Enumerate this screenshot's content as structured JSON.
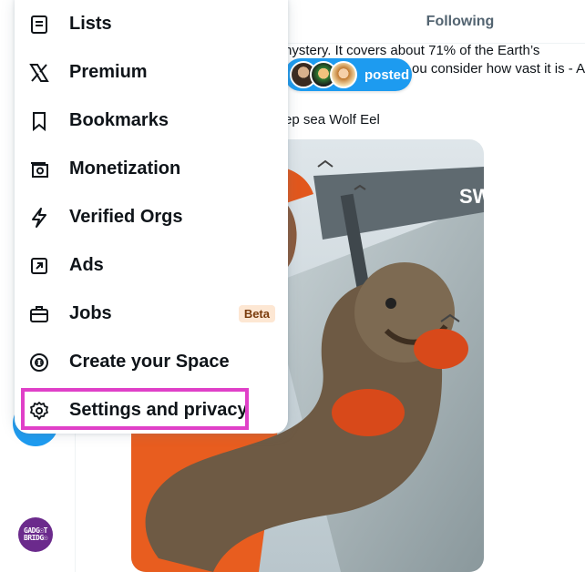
{
  "timeline": {
    "tab_following": "Following",
    "post_line1": "nystery. It covers about 71% of the Earth’s",
    "post_line2": "ou consider how vast it is - A",
    "posted_label": "posted",
    "caption": "ep sea Wolf Eel",
    "image_desc_icon": "photo-fisherman-wolf-eel",
    "profile_avatar_text": "GADG☉T BRIDG☉"
  },
  "menu": {
    "items": [
      {
        "label": "Lists",
        "icon": "list-icon"
      },
      {
        "label": "Premium",
        "icon": "x-logo-icon"
      },
      {
        "label": "Bookmarks",
        "icon": "bookmark-icon"
      },
      {
        "label": "Monetization",
        "icon": "money-icon"
      },
      {
        "label": "Verified Orgs",
        "icon": "lightning-icon"
      },
      {
        "label": "Ads",
        "icon": "arrow-up-right-box-icon"
      },
      {
        "label": "Jobs",
        "icon": "briefcase-icon",
        "badge": "Beta"
      },
      {
        "label": "Create your Space",
        "icon": "microphone-space-icon"
      },
      {
        "label": "Settings and privacy",
        "icon": "gear-icon",
        "highlighted": true
      }
    ]
  },
  "colors": {
    "accent": "#1d9bf0",
    "highlight": "#e040c8",
    "beta_bg": "#fde7d3"
  }
}
